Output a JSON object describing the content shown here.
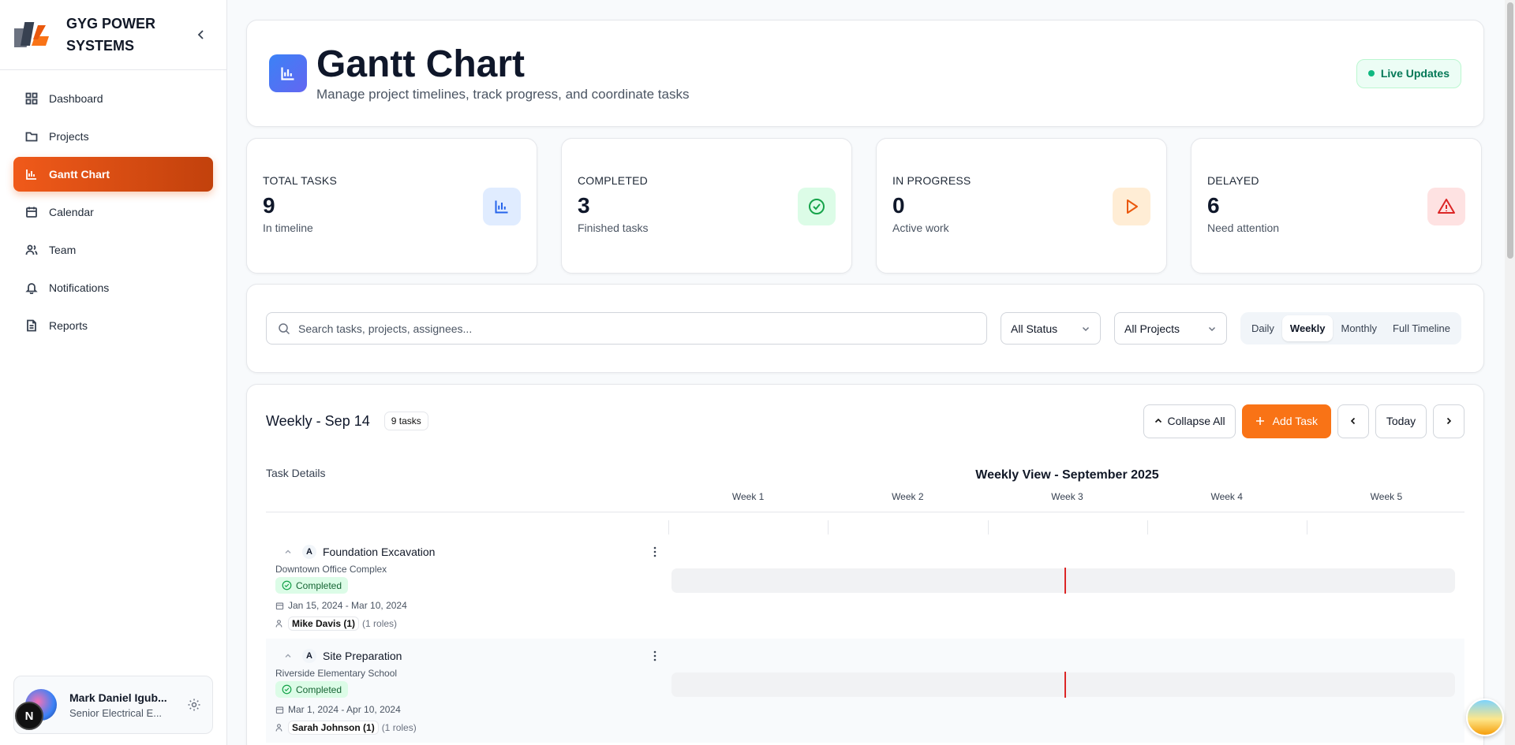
{
  "sidebar": {
    "brand": "GYG POWER SYSTEMS",
    "items": [
      {
        "label": "Dashboard",
        "icon": "dashboard-icon"
      },
      {
        "label": "Projects",
        "icon": "folder-icon"
      },
      {
        "label": "Gantt Chart",
        "icon": "bar-chart-icon"
      },
      {
        "label": "Calendar",
        "icon": "calendar-icon"
      },
      {
        "label": "Team",
        "icon": "users-icon"
      },
      {
        "label": "Notifications",
        "icon": "bell-icon"
      },
      {
        "label": "Reports",
        "icon": "file-icon"
      }
    ],
    "active": "Gantt Chart",
    "user": {
      "name": "Mark Daniel Igub...",
      "role": "Senior Electrical E..."
    },
    "badge": "N"
  },
  "header": {
    "title": "Gantt Chart",
    "subtitle": "Manage project timelines, track progress, and coordinate tasks",
    "live": "Live Updates"
  },
  "stats": [
    {
      "label": "TOTAL TASKS",
      "value": "9",
      "sub": "In timeline",
      "color": "#2563eb",
      "bg": "#e0ecff",
      "icon": "bar-chart-icon"
    },
    {
      "label": "COMPLETED",
      "value": "3",
      "sub": "Finished tasks",
      "color": "#16a34a",
      "bg": "#dcfce7",
      "icon": "check-circle-icon"
    },
    {
      "label": "IN PROGRESS",
      "value": "0",
      "sub": "Active work",
      "color": "#ea580c",
      "bg": "#ffedd5",
      "icon": "play-icon"
    },
    {
      "label": "DELAYED",
      "value": "6",
      "sub": "Need attention",
      "color": "#dc2626",
      "bg": "#fee2e2",
      "icon": "alert-triangle-icon"
    }
  ],
  "filters": {
    "search_placeholder": "Search tasks, projects, assignees...",
    "status": "All Status",
    "projects": "All Projects",
    "views": [
      "Daily",
      "Weekly",
      "Monthly",
      "Full Timeline"
    ],
    "active_view": "Weekly"
  },
  "gantt": {
    "title": "Weekly - Sep 14",
    "task_count": "9 tasks",
    "collapse": "Collapse All",
    "add": "Add Task",
    "today": "Today",
    "task_details": "Task Details",
    "view_title": "Weekly View - September 2025",
    "weeks": [
      "Week 1",
      "Week 2",
      "Week 3",
      "Week 4",
      "Week 5"
    ],
    "tasks": [
      {
        "letter": "A",
        "name": "Foundation Excavation",
        "project": "Downtown Office Complex",
        "status": "Completed",
        "dates": "Jan 15, 2024 - Mar 10, 2024",
        "assignee": "Mike Davis (1)",
        "roles": "(1 roles)"
      },
      {
        "letter": "A",
        "name": "Site Preparation",
        "project": "Riverside Elementary School",
        "status": "Completed",
        "dates": "Mar 1, 2024 - Apr 10, 2024",
        "assignee": "Sarah Johnson (1)",
        "roles": "(1 roles)"
      }
    ]
  }
}
